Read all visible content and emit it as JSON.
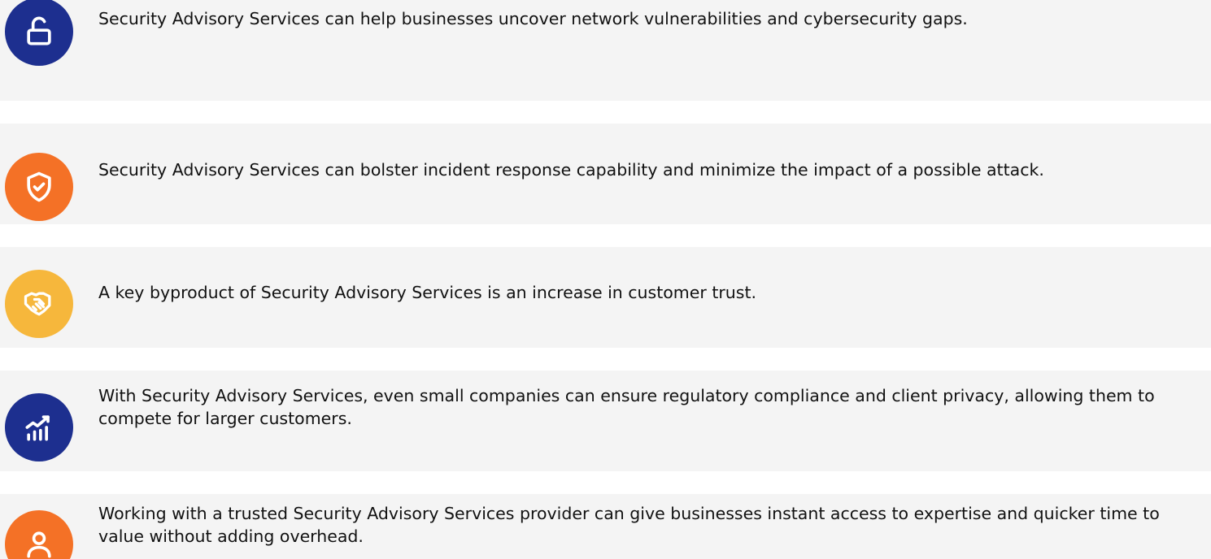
{
  "colors": {
    "navy": "#1d2f8f",
    "orange": "#f47126",
    "yellow": "#f6b73c",
    "row_bg": "#f4f4f4",
    "text": "#111111"
  },
  "items": [
    {
      "icon": "unlock-icon",
      "color": "#1d2f8f",
      "text": "Security Advisory Services can help businesses uncover network vulnerabilities and cybersecurity gaps."
    },
    {
      "icon": "shield-check-icon",
      "color": "#f47126",
      "text": "Security Advisory Services can bolster incident response capability and minimize the impact of a possible attack."
    },
    {
      "icon": "handshake-icon",
      "color": "#f6b73c",
      "text": "A key byproduct of Security Advisory Services is an increase in customer trust."
    },
    {
      "icon": "growth-chart-icon",
      "color": "#1d2f8f",
      "text": "With Security Advisory Services, even small companies can ensure regulatory compliance and client privacy, allowing them to compete for larger customers."
    },
    {
      "icon": "user-icon",
      "color": "#f47126",
      "text": "Working with a trusted Security Advisory Services provider can give businesses instant access to expertise and quicker time to value without adding overhead."
    }
  ]
}
